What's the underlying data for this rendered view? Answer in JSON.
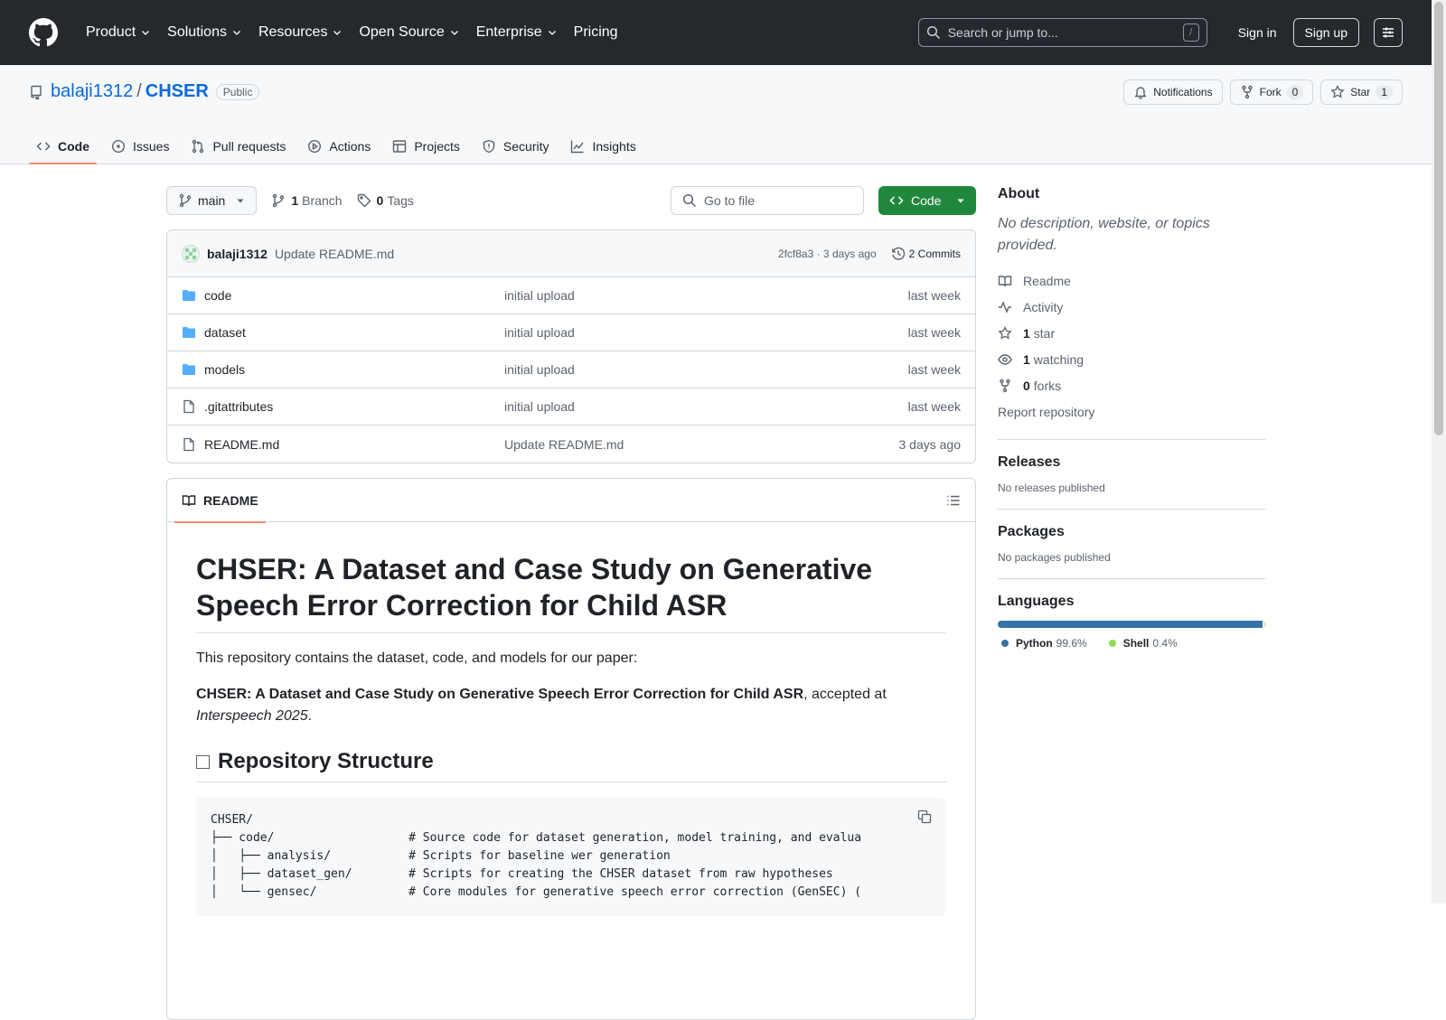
{
  "header": {
    "nav": [
      "Product",
      "Solutions",
      "Resources",
      "Open Source",
      "Enterprise",
      "Pricing"
    ],
    "search_placeholder": "Search or jump to...",
    "search_shortcut": "/",
    "signin": "Sign in",
    "signup": "Sign up"
  },
  "repo": {
    "owner": "balaji1312",
    "separator": "/",
    "name": "CHSER",
    "visibility": "Public",
    "notifications": "Notifications",
    "fork_label": "Fork",
    "fork_count": "0",
    "star_label": "Star",
    "star_count": "1"
  },
  "tabs": [
    "Code",
    "Issues",
    "Pull requests",
    "Actions",
    "Projects",
    "Security",
    "Insights"
  ],
  "toolbar": {
    "branch": "main",
    "branch_count": "1",
    "branch_label": "Branch",
    "tag_count": "0",
    "tag_label": "Tags",
    "go_to_file": "Go to file",
    "code_button": "Code"
  },
  "commit": {
    "author": "balaji1312",
    "message": "Update README.md",
    "hash_time": "2fcf8a3 · 3 days ago",
    "commits": "2 Commits"
  },
  "files": [
    {
      "name": "code",
      "type": "dir",
      "message": "initial upload",
      "date": "last week"
    },
    {
      "name": "dataset",
      "type": "dir",
      "message": "initial upload",
      "date": "last week"
    },
    {
      "name": "models",
      "type": "dir",
      "message": "initial upload",
      "date": "last week"
    },
    {
      "name": ".gitattributes",
      "type": "file",
      "message": "initial upload",
      "date": "last week"
    },
    {
      "name": "README.md",
      "type": "file",
      "message": "Update README.md",
      "date": "3 days ago"
    }
  ],
  "readme": {
    "tab": "README",
    "title": "CHSER: A Dataset and Case Study on Generative Speech Error Correction for Child ASR",
    "intro": "This repository contains the dataset, code, and models for our paper:",
    "paper_bold": "CHSER: A Dataset and Case Study on Generative Speech Error Correction for Child ASR",
    "paper_rest": ", accepted at ",
    "venue": "Interspeech 2025",
    "venue_end": ".",
    "section": "Repository Structure",
    "code_block": "CHSER/\n├── code/                   # Source code for dataset generation, model training, and evalua\n│   ├── analysis/           # Scripts for baseline wer generation\n│   ├── dataset_gen/        # Scripts for creating the CHSER dataset from raw hypotheses\n│   └── gensec/             # Core modules for generative speech error correction (GenSEC) ("
  },
  "sidebar": {
    "about_title": "About",
    "about_desc": "No description, website, or topics provided.",
    "readme": "Readme",
    "activity": "Activity",
    "stars_count": "1",
    "stars_label": "star",
    "watching_count": "1",
    "watching_label": "watching",
    "forks_count": "0",
    "forks_label": "forks",
    "report": "Report repository",
    "releases_title": "Releases",
    "releases_desc": "No releases published",
    "packages_title": "Packages",
    "packages_desc": "No packages published",
    "languages_title": "Languages",
    "languages": [
      {
        "name": "Python",
        "percent": "99.6%",
        "value": 99.6,
        "color": "#3572A5"
      },
      {
        "name": "Shell",
        "percent": "0.4%",
        "value": 0.4,
        "color": "#89e051"
      }
    ]
  },
  "colors": {
    "accent": "#0969da",
    "green": "#1f883d",
    "tab_underline": "#fd8c73",
    "header_bg": "#25292e"
  }
}
